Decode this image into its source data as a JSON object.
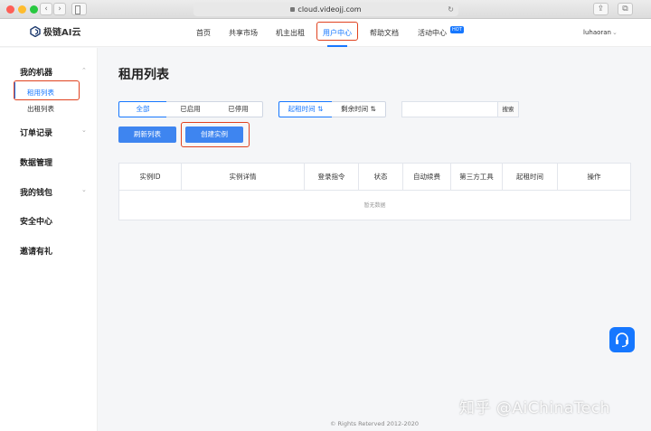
{
  "browser": {
    "url": "cloud.videojj.com"
  },
  "logo": {
    "text": "极链AI云"
  },
  "nav": {
    "items": [
      "首页",
      "共享市场",
      "机主出租",
      "用户中心",
      "帮助文档",
      "活动中心"
    ],
    "hot_badge": "HOT",
    "username": "luhaoran"
  },
  "sidebar": {
    "my_machines": "我的机器",
    "rent_list": "租用列表",
    "lease_list": "出租列表",
    "orders": "订单记录",
    "data_mgmt": "数据管理",
    "wallet": "我的钱包",
    "security": "安全中心",
    "invite": "邀请有礼"
  },
  "main": {
    "title": "租用列表",
    "filters": [
      "全部",
      "已启用",
      "已停用"
    ],
    "sort": {
      "start_time": "起租时间",
      "remaining": "剩余时间"
    },
    "search_placeholder": "",
    "search_button": "搜索",
    "refresh_button": "刷新列表",
    "create_button": "创建实例",
    "table": {
      "headers": [
        "实例ID",
        "实例详情",
        "登录指令",
        "状态",
        "自动续费",
        "第三方工具",
        "起租时间",
        "操作"
      ],
      "empty": "暂无数据"
    }
  },
  "footer": "© Rights Reterved 2012-2020",
  "watermark": "知乎 @AiChinaTech",
  "colors": {
    "primary": "#1677ff",
    "highlight": "#e0421f"
  }
}
